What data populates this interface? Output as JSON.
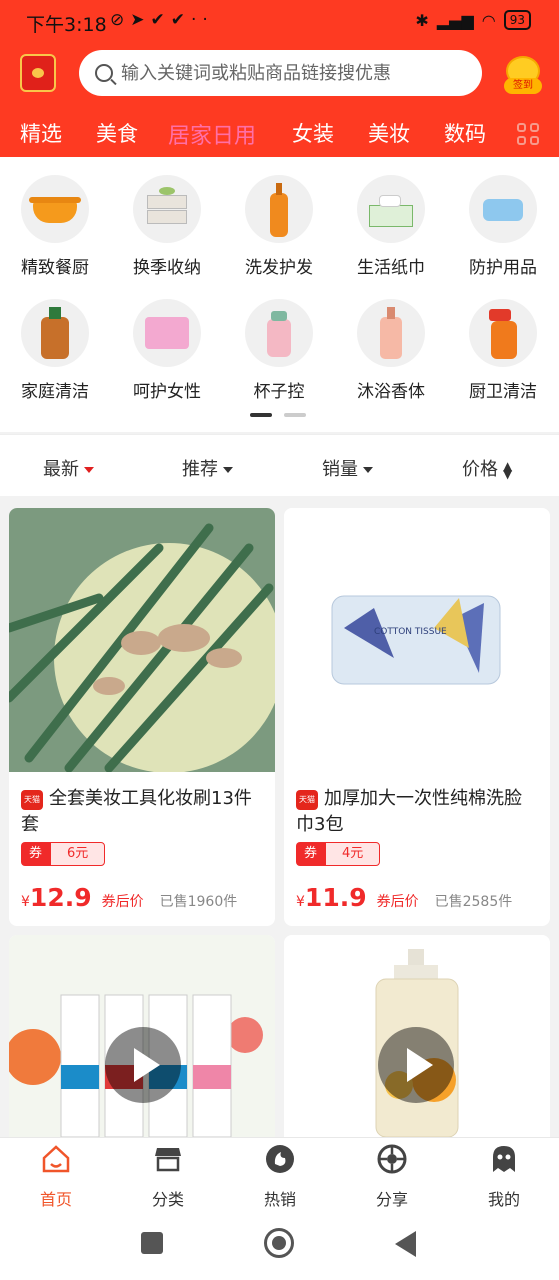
{
  "status": {
    "time": "下午3:18",
    "battery": "93"
  },
  "header": {
    "search_placeholder": "输入关键词或粘贴商品链接搜优惠",
    "signin_label": "签到"
  },
  "tabs": [
    {
      "label": "精选"
    },
    {
      "label": "美食"
    },
    {
      "label": "居家日用"
    },
    {
      "label": "女装"
    },
    {
      "label": "美妆"
    },
    {
      "label": "数码"
    }
  ],
  "categories": [
    {
      "label": "精致餐厨"
    },
    {
      "label": "换季收纳"
    },
    {
      "label": "洗发护发"
    },
    {
      "label": "生活纸巾"
    },
    {
      "label": "防护用品"
    },
    {
      "label": "家庭清洁"
    },
    {
      "label": "呵护女性"
    },
    {
      "label": "杯子控"
    },
    {
      "label": "沐浴香体"
    },
    {
      "label": "厨卫清洁"
    }
  ],
  "sort": [
    {
      "label": "最新"
    },
    {
      "label": "推荐"
    },
    {
      "label": "销量"
    },
    {
      "label": "价格"
    }
  ],
  "products": [
    {
      "badge": "天猫",
      "title": "全套美妆工具化妆刷13件套",
      "coupon_label": "券",
      "coupon_value": "6元",
      "currency": "¥",
      "price": "12.9",
      "price_note": "券后价",
      "sold": "已售1960件"
    },
    {
      "badge": "天猫",
      "title": "加厚加大一次性纯棉洗脸巾3包",
      "coupon_label": "券",
      "coupon_value": "4元",
      "currency": "¥",
      "price": "11.9",
      "price_note": "券后价",
      "sold": "已售2585件",
      "package_text": "COTTON TISSUE"
    }
  ],
  "bottom_nav": [
    {
      "label": "首页"
    },
    {
      "label": "分类"
    },
    {
      "label": "热销"
    },
    {
      "label": "分享"
    },
    {
      "label": "我的"
    }
  ],
  "colors": {
    "brand_red": "#fe3a22",
    "active_tab": "#ff6fa6",
    "price_red": "#f02a2a",
    "nav_active": "#f0552a"
  }
}
